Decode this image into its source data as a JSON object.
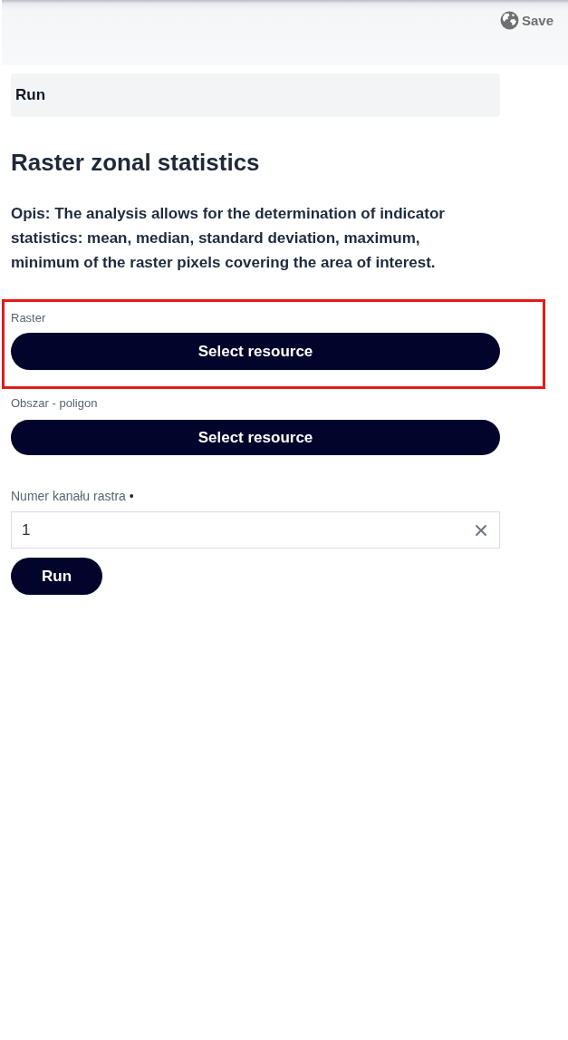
{
  "toolbar": {
    "save_label": "Save"
  },
  "section_header": "Run",
  "title": "Raster zonal statistics",
  "description": "Opis: The analysis allows for the determination of indicator statistics: mean, median, standard deviation, maximum, minimum of the raster pixels covering the area of interest.",
  "fields": [
    {
      "kind": "resource",
      "label": "Raster",
      "button": "Select resource",
      "highlighted": true
    },
    {
      "kind": "resource",
      "label": "Obszar - poligon",
      "button": "Select resource",
      "highlighted": false
    },
    {
      "kind": "number",
      "label": "Numer kanału rastra",
      "required_mark": "•",
      "value": "1",
      "highlighted": false
    }
  ],
  "run_button": "Run"
}
